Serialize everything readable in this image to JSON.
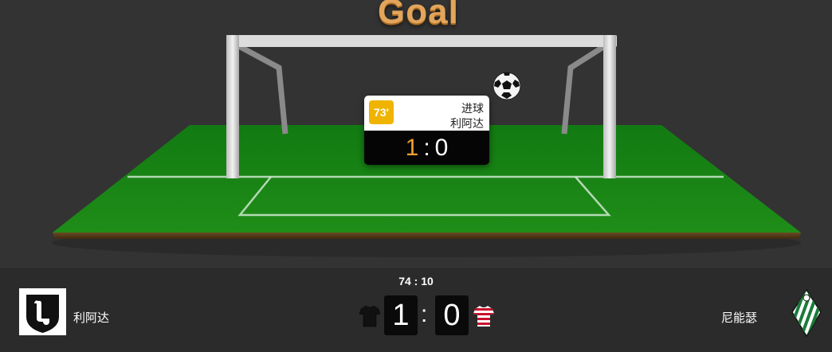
{
  "stage": {
    "title": "Goal",
    "event": {
      "minute": "73'",
      "type": "进球",
      "team": "利阿达",
      "score_home": "1",
      "score_separator": ":",
      "score_away": "0"
    },
    "icons": {
      "ball": "soccer-ball-icon"
    }
  },
  "scoreboard": {
    "match_time": "74 : 10",
    "home": {
      "name": "利阿达",
      "score": "1",
      "shirt_color": "#111111",
      "logo": "leonesa-crest-icon"
    },
    "away": {
      "name": "尼能瑟",
      "score": "0",
      "shirt_color": "#c8102e",
      "logo": "green-white-striped-crest-icon"
    },
    "separator": ":"
  },
  "colors": {
    "accent_orange": "#f0a030",
    "minute_badge": "#f0b400",
    "pitch_green": "#1a8a1a",
    "background": "#333333"
  }
}
